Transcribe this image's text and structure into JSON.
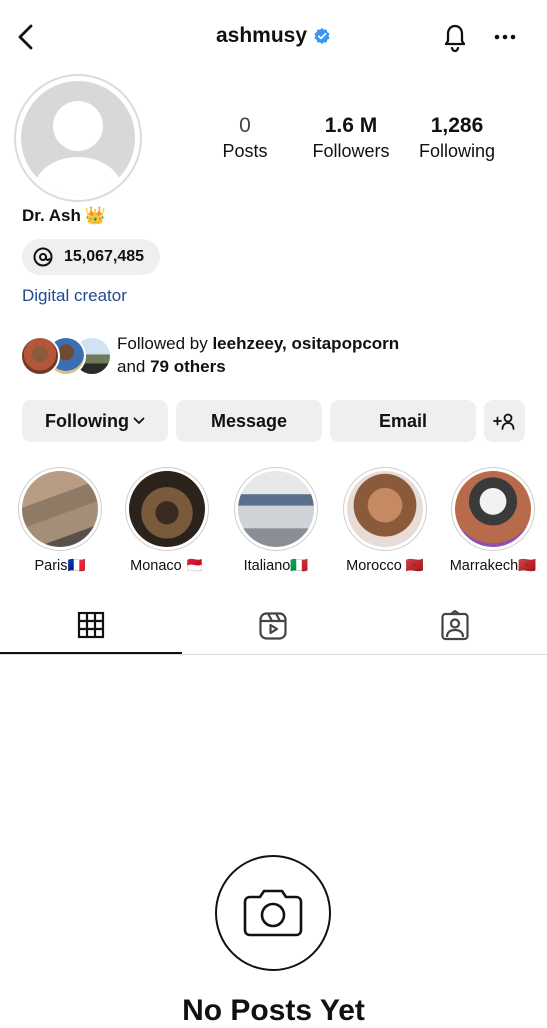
{
  "header": {
    "username": "ashmusy",
    "icons": [
      "back-icon",
      "verified-badge-icon",
      "bell-icon",
      "more-icon"
    ]
  },
  "profile": {
    "display_name": "Dr. Ash",
    "name_emoji": "👑",
    "threads_count": "15,067,485",
    "category": "Digital creator"
  },
  "stats": [
    {
      "value": "0",
      "label": "Posts"
    },
    {
      "value": "1.6 M",
      "label": "Followers"
    },
    {
      "value": "1,286",
      "label": "Following"
    }
  ],
  "mutuals": {
    "prefix": "Followed by ",
    "names": "leehzeey, ositapopcorn",
    "and": "and ",
    "others": "79 others"
  },
  "actions": {
    "following": "Following",
    "message": "Message",
    "email": "Email"
  },
  "highlights": [
    {
      "label": "Paris🇫🇷"
    },
    {
      "label": "Monaco 🇲🇨"
    },
    {
      "label": "Italiano🇮🇹"
    },
    {
      "label": "Morocco 🇲🇦"
    },
    {
      "label": "Marrakech🇲🇦"
    }
  ],
  "tabs": [
    "grid-icon",
    "reels-icon",
    "tagged-icon"
  ],
  "empty_state": {
    "title": "No Posts Yet"
  },
  "colors": {
    "accent_link": "#1d4b8f",
    "verified": "#3897f0",
    "button_bg": "#efefef"
  }
}
